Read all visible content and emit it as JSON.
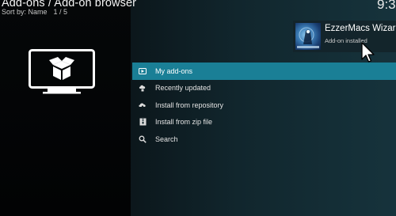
{
  "header": {
    "breadcrumb": "Add-ons / Add-on browser",
    "sort_label": "Sort by: Name",
    "counter": "1 / 5",
    "clock": "9:3"
  },
  "hero_icon": "tv-with-box-icon",
  "menu": {
    "items": [
      {
        "label": "My add-ons",
        "icon": "box-icon",
        "selected": true
      },
      {
        "label": "Recently updated",
        "icon": "cloud-update-icon",
        "selected": false
      },
      {
        "label": "Install from repository",
        "icon": "repository-icon",
        "selected": false
      },
      {
        "label": "Install from zip file",
        "icon": "zip-file-icon",
        "selected": false
      },
      {
        "label": "Search",
        "icon": "search-icon",
        "selected": false
      }
    ]
  },
  "notification": {
    "title": "EzzerMacs Wizard",
    "message": "Add-on installed",
    "icon": "wizard-thumbnail"
  },
  "colors": {
    "accent": "#1a7f96",
    "background_dark": "#050708",
    "background_teal": "#16333c"
  }
}
